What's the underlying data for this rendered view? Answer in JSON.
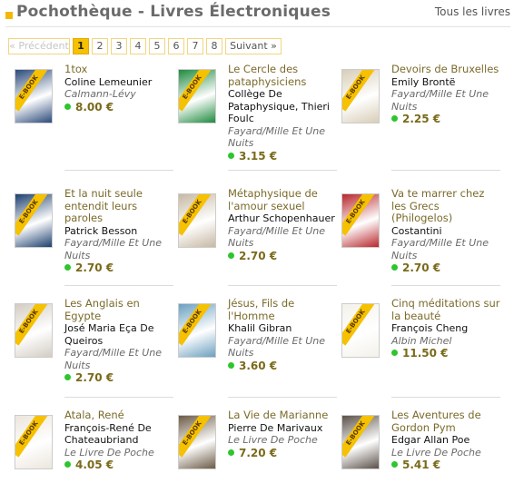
{
  "header": {
    "title": "Pochothèque - Livres Électroniques",
    "all_link": "Tous les livres"
  },
  "pager": {
    "prev": "« Précédent",
    "pages": [
      "1",
      "2",
      "3",
      "4",
      "5",
      "6",
      "7",
      "8"
    ],
    "current": "1",
    "next": "Suivant »"
  },
  "badge": "E-BOOK",
  "books": [
    {
      "title": "1tox",
      "author": "Coline Lemeunier",
      "publisher": "Calmann-Lévy",
      "price": "8.00 €",
      "cover_color": "#2b4a7a"
    },
    {
      "title": "Le Cercle des pataphysiciens",
      "author": "Collège De Pataphysique, Thieri Foulc",
      "publisher": "Fayard/Mille Et Une Nuits",
      "price": "3.15 €",
      "cover_color": "#1e8a3e"
    },
    {
      "title": "Devoirs de Bruxelles",
      "author": "Emily Brontë",
      "publisher": "Fayard/Mille Et Une Nuits",
      "price": "2.25 €",
      "cover_color": "#d8cdb7"
    },
    {
      "title": "Et la nuit seule entendit leurs paroles",
      "author": "Patrick Besson",
      "publisher": "Fayard/Mille Et Une Nuits",
      "price": "2.70 €",
      "cover_color": "#1b3f6e"
    },
    {
      "title": "Métaphysique de l'amour sexuel",
      "author": "Arthur Schopenhauer",
      "publisher": "Fayard/Mille Et Une Nuits",
      "price": "2.70 €",
      "cover_color": "#c7b8a3"
    },
    {
      "title": "Va te marrer chez les Grecs (Philogelos)",
      "author": "Costantini",
      "publisher": "Fayard/Mille Et Une Nuits",
      "price": "2.70 €",
      "cover_color": "#b8262b"
    },
    {
      "title": "Les Anglais en Egypte",
      "author": "José Maria Eça De Queiros",
      "publisher": "Fayard/Mille Et Une Nuits",
      "price": "2.70 €",
      "cover_color": "#d3ccc2"
    },
    {
      "title": "Jésus, Fils de l'Homme",
      "author": "Khalil Gibran",
      "publisher": "Fayard/Mille Et Une Nuits",
      "price": "3.60 €",
      "cover_color": "#6aa0c0"
    },
    {
      "title": "Cinq méditations sur la beauté",
      "author": "François Cheng",
      "publisher": "Albin Michel",
      "price": "11.50 €",
      "cover_color": "#f3f1ea"
    },
    {
      "title": "Atala, René",
      "author": "François-René De Chateaubriand",
      "publisher": "Le Livre De Poche",
      "price": "4.05 €",
      "cover_color": "#ece6dc"
    },
    {
      "title": "La Vie de Marianne",
      "author": "Pierre De Marivaux",
      "publisher": "Le Livre De Poche",
      "price": "7.20 €",
      "cover_color": "#6c5a45"
    },
    {
      "title": "Les Aventures de Gordon Pym",
      "author": "Edgar Allan Poe",
      "publisher": "Le Livre De Poche",
      "price": "5.41 €",
      "cover_color": "#5a5048"
    }
  ]
}
